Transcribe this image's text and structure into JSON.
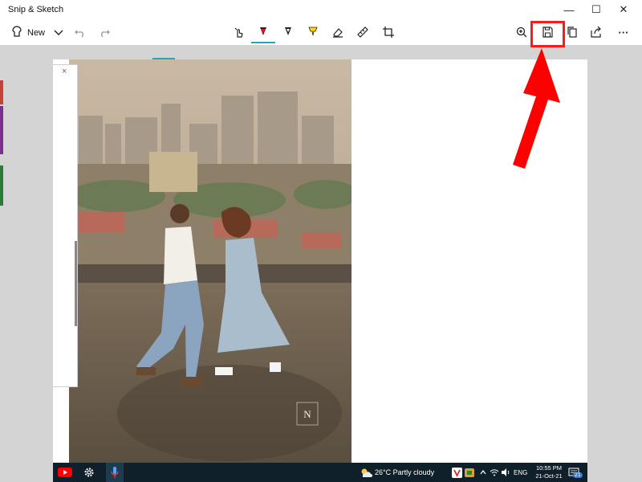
{
  "window": {
    "title": "Snip & Sketch",
    "minimize_glyph": "—",
    "maximize_glyph": "☐",
    "close_glyph": "✕"
  },
  "toolbar": {
    "new_label": "New",
    "icons": [
      "new-snip-icon",
      "chevron-down-icon",
      "undo-icon",
      "redo-icon",
      "touch-writing-icon",
      "ballpoint-pen-icon",
      "pencil-icon",
      "highlighter-icon",
      "eraser-icon",
      "ruler-icon",
      "crop-icon",
      "zoom-icon",
      "save-icon",
      "copy-icon",
      "share-icon",
      "more-icon"
    ],
    "more_glyph": "···",
    "active_pen_color": "#e81123",
    "highlighter_color": "#ffd800"
  },
  "side_panel": {
    "close_glyph": "×"
  },
  "annotation": {
    "highlight_color": "#ff1a1a",
    "arrow_color": "#ff0000"
  },
  "photo": {
    "watermark": "N"
  },
  "taskbar": {
    "weather": "26°C  Partly cloudy",
    "language": "ENG",
    "time": "10:55 PM",
    "date": "21-Oct-21",
    "notification_count": "21"
  }
}
